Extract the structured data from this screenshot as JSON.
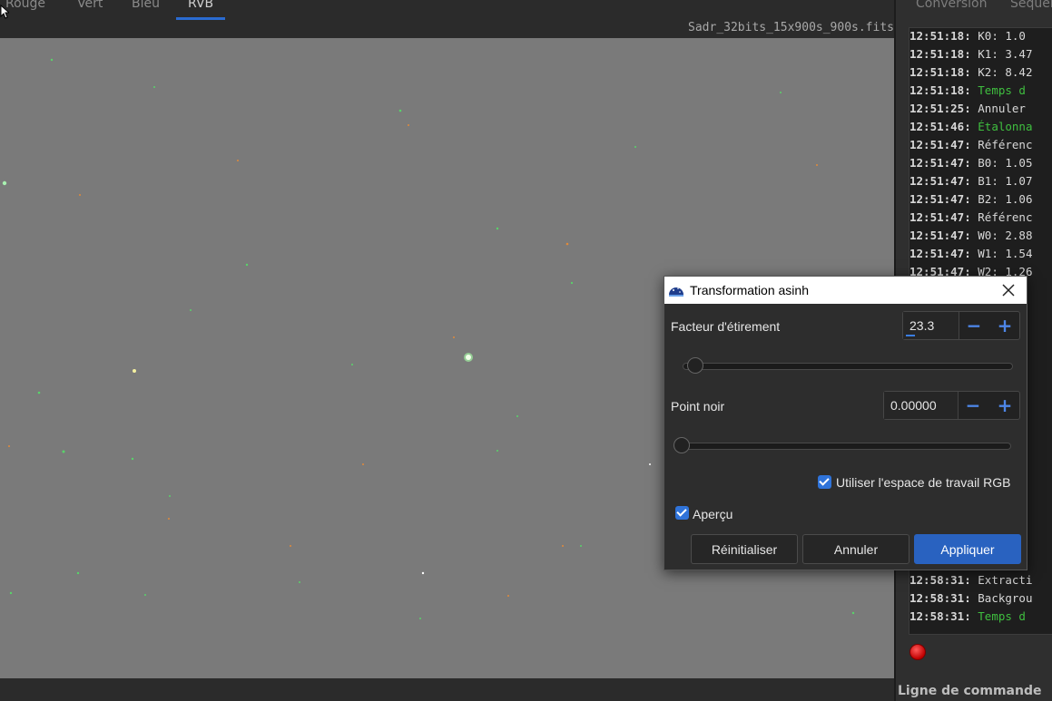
{
  "tabs": {
    "items": [
      {
        "label": "Rouge",
        "active": false
      },
      {
        "label": "Vert",
        "active": false
      },
      {
        "label": "Bleu",
        "active": false
      },
      {
        "label": "RVB",
        "active": true
      }
    ]
  },
  "file": {
    "name": "Sadr_32bits_15x900s_900s.fits"
  },
  "right_panel": {
    "tabs": [
      "Conversion",
      "Séquen"
    ],
    "console_lines": [
      {
        "time": "12:51:18:",
        "text": "K0: 1.0",
        "color": "normal"
      },
      {
        "time": "12:51:18:",
        "text": "K1: 3.47",
        "color": "normal"
      },
      {
        "time": "12:51:18:",
        "text": "K2: 8.42",
        "color": "normal"
      },
      {
        "time": "12:51:18:",
        "text": "Temps d",
        "color": "green"
      },
      {
        "time": "12:51:25:",
        "text": "Annuler",
        "color": "normal"
      },
      {
        "time": "12:51:46:",
        "text": "Étalonna",
        "color": "green"
      },
      {
        "time": "12:51:47:",
        "text": "Référenc",
        "color": "normal"
      },
      {
        "time": "12:51:47:",
        "text": "B0: 1.05",
        "color": "normal"
      },
      {
        "time": "12:51:47:",
        "text": "B1: 1.07",
        "color": "normal"
      },
      {
        "time": "12:51:47:",
        "text": "B2: 1.06",
        "color": "normal"
      },
      {
        "time": "12:51:47:",
        "text": "Référenc",
        "color": "normal"
      },
      {
        "time": "12:51:47:",
        "text": "W0: 2.88",
        "color": "normal"
      },
      {
        "time": "12:51:47:",
        "text": "W1: 1.54",
        "color": "normal"
      },
      {
        "time": "12:51:47:",
        "text": "W2: 1.26",
        "color": "normal"
      },
      {
        "time": "",
        "text": "",
        "color": "normal"
      },
      {
        "time": "",
        "text": "",
        "color": "normal"
      },
      {
        "time": "",
        "text": "",
        "color": "normal"
      },
      {
        "time": "",
        "text": "",
        "color": "normal"
      },
      {
        "time": "",
        "text": "",
        "color": "normal"
      },
      {
        "time": "",
        "text": "",
        "color": "normal"
      },
      {
        "time": "",
        "text": "",
        "color": "normal"
      },
      {
        "time": "",
        "text": "",
        "color": "normal"
      },
      {
        "time": "",
        "text": "",
        "color": "normal"
      },
      {
        "time": "",
        "text": "",
        "color": "normal"
      },
      {
        "time": "",
        "text": "",
        "color": "normal"
      },
      {
        "time": "",
        "text": "",
        "color": "normal"
      },
      {
        "time": "",
        "text": "",
        "color": "normal"
      },
      {
        "time": "",
        "text": "",
        "color": "normal"
      },
      {
        "time": "",
        "text": "",
        "color": "normal"
      },
      {
        "time": "",
        "text": "",
        "color": "normal"
      },
      {
        "time": "12:58:31:",
        "text": "Extracti",
        "color": "normal"
      },
      {
        "time": "12:58:31:",
        "text": "Backgrou",
        "color": "normal"
      },
      {
        "time": "12:58:31:",
        "text": "Temps d",
        "color": "green"
      }
    ],
    "command_label": "Ligne de commande"
  },
  "dialog": {
    "title": "Transformation asinh",
    "stretch": {
      "label": "Facteur d'étirement",
      "value": "23.3",
      "slider_fraction": 0.02
    },
    "blackpoint": {
      "label": "Point noir",
      "value": "0.00000",
      "slider_fraction": 0.0
    },
    "rgb_checkbox": {
      "label": "Utiliser l'espace de travail RGB",
      "checked": true
    },
    "preview_checkbox": {
      "label": "Aperçu",
      "checked": true
    },
    "buttons": {
      "reset": "Réinitialiser",
      "cancel": "Annuler",
      "apply": "Appliquer"
    },
    "minus": "−",
    "plus": "+"
  },
  "icons": {
    "close": "close-icon",
    "app": "siril-icon",
    "stop": "stop-icon"
  }
}
